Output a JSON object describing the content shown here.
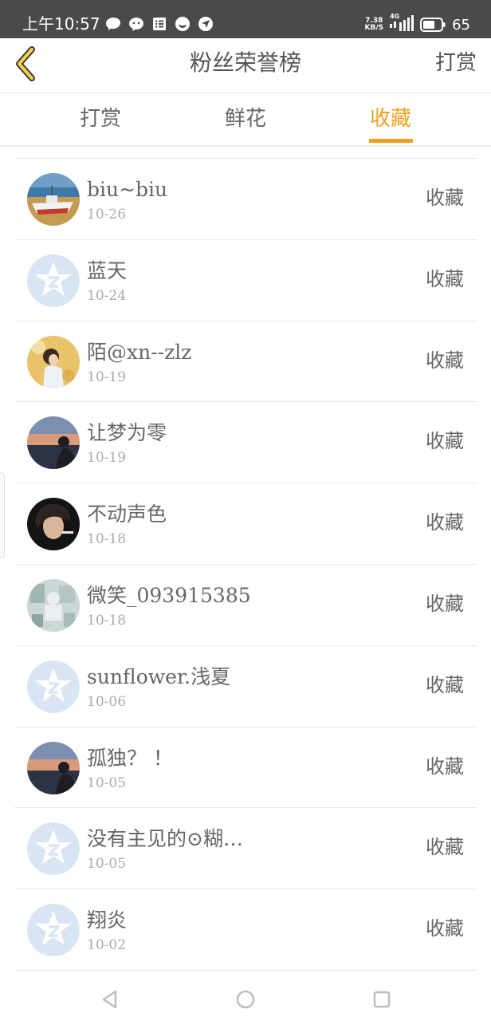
{
  "status_bar": {
    "time": "上午10:57",
    "net_speed_value": "7.38",
    "net_speed_unit": "KB/S",
    "network_type": "4G",
    "battery": "65",
    "icons": [
      "chat-bubble-icon",
      "wechat-icon",
      "notes-icon",
      "app-icon",
      "location-icon"
    ]
  },
  "header": {
    "back_icon": "chevron-left-icon",
    "title": "粉丝荣誉榜",
    "action": "打赏"
  },
  "tabs": [
    {
      "label": "打赏",
      "active": false
    },
    {
      "label": "鲜花",
      "active": false
    },
    {
      "label": "收藏",
      "active": true
    }
  ],
  "colors": {
    "accent": "#f0a020",
    "text": "#666666",
    "muted": "#aaaaaa",
    "divider": "#e8e8e8",
    "default_avatar": "#d8e6f3"
  },
  "fans": [
    {
      "name": "biu~biu",
      "date": "10-26",
      "action": "收藏",
      "avatar": "boat-photo"
    },
    {
      "name": "蓝天",
      "date": "10-24",
      "action": "收藏",
      "avatar": "default-avatar"
    },
    {
      "name": "陌@xn--zlz",
      "date": "10-19",
      "action": "收藏",
      "avatar": "girl-field-photo"
    },
    {
      "name": "让梦为零",
      "date": "10-19",
      "action": "收藏",
      "avatar": "sunset-silhouette-photo"
    },
    {
      "name": "不动声色",
      "date": "10-18",
      "action": "收藏",
      "avatar": "portrait-dark-photo"
    },
    {
      "name": "微笑_093915385",
      "date": "10-18",
      "action": "收藏",
      "avatar": "sketch-photo"
    },
    {
      "name": "sunflower.浅夏",
      "date": "10-06",
      "action": "收藏",
      "avatar": "default-avatar"
    },
    {
      "name": "孤独？ ！",
      "date": "10-05",
      "action": "收藏",
      "avatar": "sunset-silhouette-photo"
    },
    {
      "name": "没有主见的⊙糊…",
      "date": "10-05",
      "action": "收藏",
      "avatar": "default-avatar"
    },
    {
      "name": "翔炎",
      "date": "10-02",
      "action": "收藏",
      "avatar": "default-avatar"
    }
  ],
  "nav_bar": {
    "back_icon": "triangle-back-icon",
    "home_icon": "circle-home-icon",
    "recents_icon": "square-recents-icon"
  }
}
